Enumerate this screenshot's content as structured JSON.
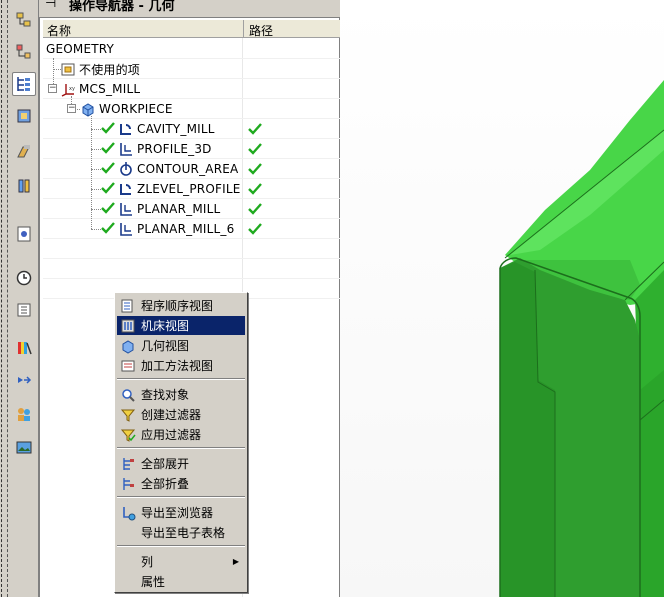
{
  "navigator": {
    "title": "操作导航器 - 几何",
    "pin_icon": "pin-icon",
    "columns": [
      "名称",
      "路径"
    ]
  },
  "tree": {
    "root": "GEOMETRY",
    "unused": "不使用的项",
    "mcs": "MCS_MILL",
    "workpiece": "WORKPIECE",
    "operations": [
      {
        "name": "CAVITY_MILL",
        "icon": "cavity-mill-icon",
        "path_ok": true
      },
      {
        "name": "PROFILE_3D",
        "icon": "profile-3d-icon",
        "path_ok": true
      },
      {
        "name": "CONTOUR_AREA",
        "icon": "contour-area-icon",
        "path_ok": true
      },
      {
        "name": "ZLEVEL_PROFILE",
        "icon": "zlevel-profile-icon",
        "path_ok": true
      },
      {
        "name": "PLANAR_MILL",
        "icon": "planar-mill-icon",
        "path_ok": true
      },
      {
        "name": "PLANAR_MILL_6",
        "icon": "planar-mill-icon",
        "path_ok": true
      }
    ]
  },
  "context_menu": {
    "items": [
      {
        "label": "程序顺序视图",
        "icon": "program-order-view-icon"
      },
      {
        "label": "机床视图",
        "icon": "machine-tool-view-icon",
        "highlighted": true
      },
      {
        "label": "几何视图",
        "icon": "geometry-view-icon"
      },
      {
        "label": "加工方法视图",
        "icon": "machining-method-view-icon"
      },
      {
        "label": "查找对象",
        "icon": "find-object-icon"
      },
      {
        "label": "创建过滤器",
        "icon": "create-filter-icon"
      },
      {
        "label": "应用过滤器",
        "icon": "apply-filter-icon"
      },
      {
        "label": "全部展开",
        "icon": "expand-all-icon"
      },
      {
        "label": "全部折叠",
        "icon": "collapse-all-icon"
      },
      {
        "label": "导出至浏览器",
        "icon": "export-browser-icon"
      },
      {
        "label": "导出至电子表格",
        "icon": ""
      },
      {
        "label": "列",
        "icon": "",
        "submenu": true
      },
      {
        "label": "属性",
        "icon": ""
      }
    ]
  },
  "colors": {
    "model_green": "#3cc83c",
    "model_dark": "#23962a",
    "highlight": "#0a246a",
    "check_green": "#1faa1f"
  }
}
